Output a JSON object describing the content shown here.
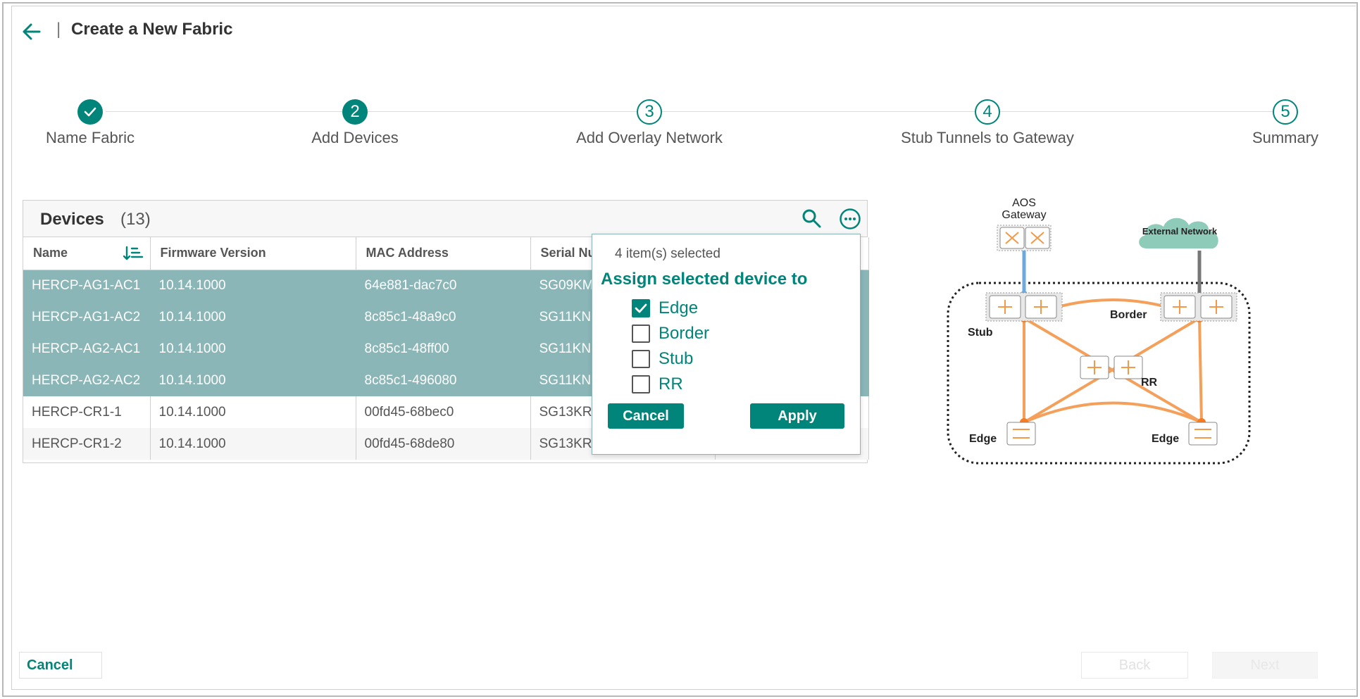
{
  "header": {
    "title": "Create a New Fabric",
    "separator": "|"
  },
  "stepper": {
    "steps": [
      {
        "number": "",
        "label": "Name Fabric",
        "state": "done"
      },
      {
        "number": "2",
        "label": "Add Devices",
        "state": "active"
      },
      {
        "number": "3",
        "label": "Add Overlay Network",
        "state": "todo"
      },
      {
        "number": "4",
        "label": "Stub Tunnels to Gateway",
        "state": "todo"
      },
      {
        "number": "5",
        "label": "Summary",
        "state": "todo"
      }
    ]
  },
  "devices": {
    "title": "Devices",
    "count": "(13)",
    "columns": [
      "Name",
      "Firmware Version",
      "MAC Address",
      "Serial Nu",
      ""
    ],
    "rows": [
      {
        "name": "HERCP-AG1-AC1",
        "firmware": "10.14.1000",
        "mac": "64e881-dac7c0",
        "serial": "SG09KM",
        "selected": true
      },
      {
        "name": "HERCP-AG1-AC2",
        "firmware": "10.14.1000",
        "mac": "8c85c1-48a9c0",
        "serial": "SG11KN",
        "selected": true
      },
      {
        "name": "HERCP-AG2-AC1",
        "firmware": "10.14.1000",
        "mac": "8c85c1-48ff00",
        "serial": "SG11KN",
        "selected": true
      },
      {
        "name": "HERCP-AG2-AC2",
        "firmware": "10.14.1000",
        "mac": "8c85c1-496080",
        "serial": "SG11KN",
        "selected": true
      },
      {
        "name": "HERCP-CR1-1",
        "firmware": "10.14.1000",
        "mac": "00fd45-68bec0",
        "serial": "SG13KR",
        "selected": false
      },
      {
        "name": "HERCP-CR1-2",
        "firmware": "10.14.1000",
        "mac": "00fd45-68de80",
        "serial": "SG13KR",
        "selected": false
      }
    ]
  },
  "assign_popup": {
    "selected_count": "4 item(s) selected",
    "title": "Assign selected device to",
    "options": [
      {
        "label": "Edge",
        "checked": true
      },
      {
        "label": "Border",
        "checked": false
      },
      {
        "label": "Stub",
        "checked": false
      },
      {
        "label": "RR",
        "checked": false
      }
    ],
    "cancel_label": "Cancel",
    "apply_label": "Apply"
  },
  "diagram": {
    "gateway_label_1": "AOS",
    "gateway_label_2": "Gateway",
    "external_label": "External Network",
    "stub_label": "Stub",
    "border_label": "Border",
    "rr_label": "RR",
    "edge_left_label": "Edge",
    "edge_right_label": "Edge"
  },
  "footer": {
    "cancel_label": "Cancel",
    "back_label": "Back",
    "next_label": "Next"
  },
  "colors": {
    "accent": "#01857a",
    "selected_row": "#8ab6b8",
    "orange": "#f5a05a",
    "blue_link": "#6fa8dc"
  }
}
